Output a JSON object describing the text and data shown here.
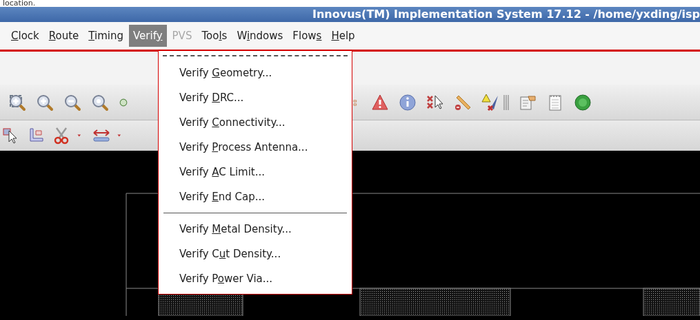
{
  "page_caption": "location.",
  "window": {
    "title": "Innovus(TM) Implementation System 17.12 - /home/yxding/isp"
  },
  "menubar": [
    {
      "key": "C",
      "post": "lock",
      "selected": false,
      "disabled": false
    },
    {
      "key": "R",
      "post": "oute",
      "selected": false,
      "disabled": false
    },
    {
      "key": "T",
      "post": "iming",
      "selected": false,
      "disabled": false
    },
    {
      "pre": "Verif",
      "key": "y",
      "selected": true,
      "disabled": false
    },
    {
      "pre": "PVS",
      "selected": false,
      "disabled": true
    },
    {
      "pre": "Too",
      "key": "l",
      "post": "s",
      "selected": false,
      "disabled": false
    },
    {
      "pre": "W",
      "key": "i",
      "post": "ndows",
      "selected": false,
      "disabled": false
    },
    {
      "pre": "Flow",
      "key": "s",
      "selected": false,
      "disabled": false
    },
    {
      "key": "H",
      "post": "elp",
      "selected": false,
      "disabled": false
    }
  ],
  "dropdown": {
    "items": [
      {
        "kind": "tearoff"
      },
      {
        "kind": "item",
        "pre": "Verify ",
        "key": "G",
        "post": "eometry..."
      },
      {
        "kind": "item",
        "pre": "Verify ",
        "key": "D",
        "post": "RC..."
      },
      {
        "kind": "item",
        "pre": "Verify ",
        "key": "C",
        "post": "onnectivity..."
      },
      {
        "kind": "item",
        "pre": "Verify ",
        "key": "P",
        "post": "rocess Antenna..."
      },
      {
        "kind": "item",
        "pre": "Verify ",
        "key": "A",
        "post": "C Limit..."
      },
      {
        "kind": "item",
        "pre": "Verify ",
        "key": "E",
        "post": "nd Cap..."
      },
      {
        "kind": "separator"
      },
      {
        "kind": "item",
        "pre": "Verify ",
        "key": "M",
        "post": "etal Density..."
      },
      {
        "kind": "item",
        "pre": "Verify C",
        "key": "u",
        "post": "t Density..."
      },
      {
        "kind": "item",
        "pre": "Verify P",
        "key": "o",
        "post": "wer Via..."
      }
    ]
  }
}
